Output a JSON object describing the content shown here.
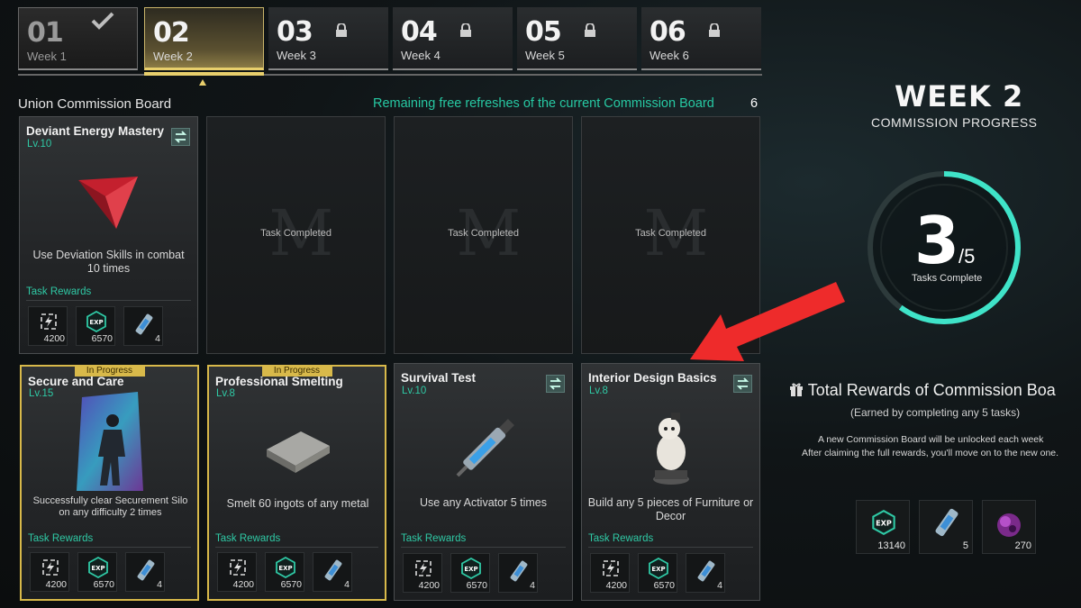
{
  "weeks": [
    {
      "num": "01",
      "label": "Week 1",
      "state": "done"
    },
    {
      "num": "02",
      "label": "Week 2",
      "state": "active"
    },
    {
      "num": "03",
      "label": "Week 3",
      "state": "locked"
    },
    {
      "num": "04",
      "label": "Week 4",
      "state": "locked"
    },
    {
      "num": "05",
      "label": "Week 5",
      "state": "locked"
    },
    {
      "num": "06",
      "label": "Week 6",
      "state": "locked"
    }
  ],
  "board": {
    "title": "Union Commission Board",
    "refresh_text": "Remaining free refreshes of the current Commission Board",
    "refresh_count": "6"
  },
  "cards": [
    {
      "title": "Deviant Energy Mastery",
      "level": "Lv.10",
      "desc": "Use Deviation Skills in combat 10 times",
      "rewards_label": "Task Rewards",
      "rewards": [
        "4200",
        "6570",
        "4"
      ]
    },
    {
      "completed": "Task Completed"
    },
    {
      "completed": "Task Completed"
    },
    {
      "completed": "Task Completed"
    },
    {
      "badge": "In Progress",
      "title": "Secure and Care",
      "level": "Lv.15",
      "desc": "Successfully clear Securement Silo on any difficulty 2 times",
      "rewards_label": "Task Rewards",
      "rewards": [
        "4200",
        "6570",
        "4"
      ]
    },
    {
      "badge": "In Progress",
      "title": "Professional Smelting",
      "level": "Lv.8",
      "desc": "Smelt 60 ingots of any metal",
      "rewards_label": "Task Rewards",
      "rewards": [
        "4200",
        "6570",
        "4"
      ]
    },
    {
      "title": "Survival Test",
      "level": "Lv.10",
      "desc": "Use any Activator 5 times",
      "rewards_label": "Task Rewards",
      "rewards": [
        "4200",
        "6570",
        "4"
      ]
    },
    {
      "title": "Interior Design Basics",
      "level": "Lv.8",
      "desc": "Build any 5 pieces of Furniture or Decor",
      "rewards_label": "Task Rewards",
      "rewards": [
        "4200",
        "6570",
        "4"
      ]
    }
  ],
  "progress": {
    "week_title": "WEEK 2",
    "subtitle": "COMMISSION PROGRESS",
    "completed": "3",
    "total": "/5",
    "label": "Tasks Complete",
    "fraction": 0.6
  },
  "total_rewards": {
    "title": "Total Rewards of Commission Boa",
    "subtitle": "(Earned by completing any 5 tasks)",
    "note1": "A new Commission Board will be unlocked each week",
    "note2": "After claiming the full rewards, you'll move on to the new one.",
    "items": [
      "13140",
      "5",
      "270"
    ]
  },
  "icons": {
    "exp": "exp-icon",
    "energy": "energy-icon",
    "activator": "activator-tube-icon",
    "lock": "lock-icon",
    "swap": "swap-icon",
    "gift": "gift-icon"
  },
  "colors": {
    "accent_teal": "#2fc9a5",
    "gold": "#d8b94a",
    "arrow_red": "#ee2b2b"
  }
}
